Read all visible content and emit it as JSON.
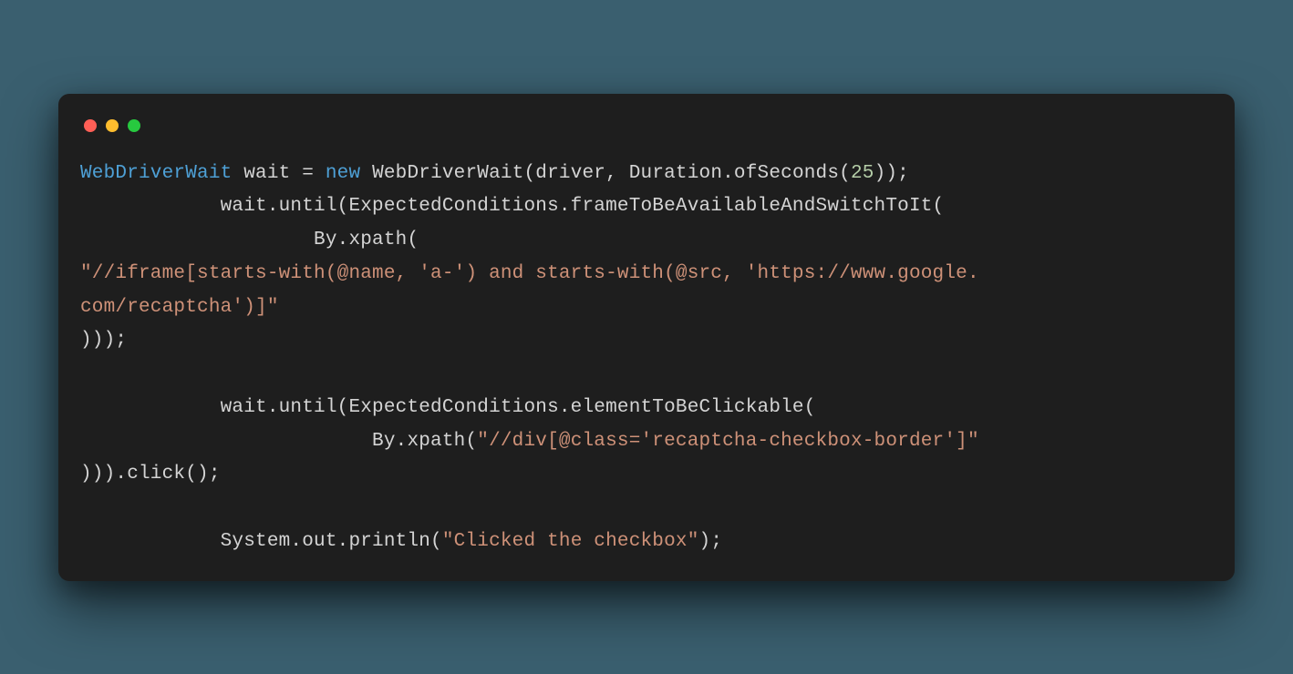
{
  "code": {
    "line1": {
      "type1": "WebDriverWait",
      "t1": " wait = ",
      "kw1": "new",
      "t2": " WebDriverWait(driver, Duration.ofSeconds(",
      "num1": "25",
      "t3": "));"
    },
    "line2": {
      "t1": "            wait.until(ExpectedConditions.frameToBeAvailableAndSwitchToIt("
    },
    "line3": {
      "t1": "                    By.xpath("
    },
    "line4": {
      "str1": "\"//iframe[starts-with(@name, 'a-') and starts-with(@src, 'https://www.google."
    },
    "line5": {
      "str1": "com/recaptcha')]\""
    },
    "line6": {
      "t1": ")));"
    },
    "line7": {
      "t1": ""
    },
    "line8": {
      "t1": "            wait.until(ExpectedConditions.elementToBeClickable("
    },
    "line9": {
      "t1": "                         By.xpath(",
      "str1": "\"//div[@class='recaptcha-checkbox-border']\""
    },
    "line10": {
      "t1": "))).click();"
    },
    "line11": {
      "t1": ""
    },
    "line12": {
      "t1": "            System.out.println(",
      "str1": "\"Clicked the checkbox\"",
      "t2": ");"
    }
  }
}
